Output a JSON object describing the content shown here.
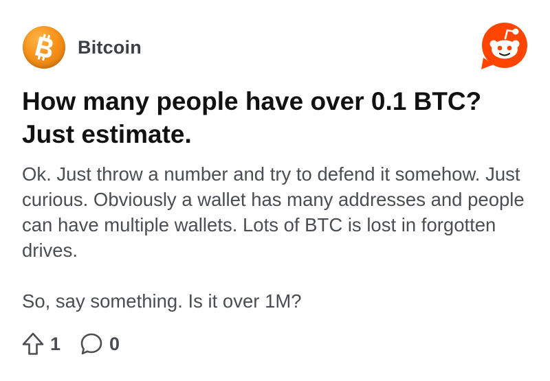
{
  "post": {
    "community": {
      "name": "Bitcoin",
      "avatar_icon": "bitcoin-logo-icon",
      "avatar_color": "#f7931a"
    },
    "brand_icon": "reddit-logo-icon",
    "brand_color": "#ff4500",
    "title": "How many people have over 0.1 BTC? Just estimate.",
    "body": [
      "Ok. Just throw a number and try to defend it somehow. Just curious. Obviously a wallet has many addresses and people can have multiple wallets. Lots of BTC is lost in forgotten drives.",
      "So, say something. Is it over 1M?"
    ],
    "votes": {
      "icon": "upvote-arrow-icon",
      "count": "1"
    },
    "comments": {
      "icon": "comment-bubble-icon",
      "count": "0"
    }
  }
}
